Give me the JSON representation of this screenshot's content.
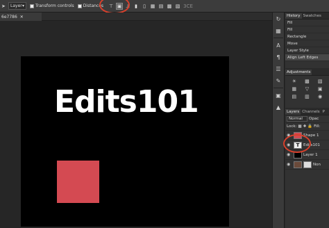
{
  "options_bar": {
    "layer_select": "Layer",
    "transform_controls": "Transform controls",
    "distances": "Distances",
    "extra": "3CE"
  },
  "document": {
    "tab_name": "6e7786"
  },
  "canvas": {
    "title": "Edits101",
    "square_color": "#d44a52"
  },
  "history": {
    "tabs": [
      "History",
      "Swatches"
    ],
    "items": [
      "Fill",
      "Fill",
      "Rectangle",
      "Move",
      "Layer Style",
      "Align Left Edges"
    ]
  },
  "adjustments": {
    "tab": "Adjustments"
  },
  "layers": {
    "tabs": [
      "Layers",
      "Channels",
      "P"
    ],
    "blend_mode": "Normal",
    "opacity_label": "Opac",
    "lock_label": "Lock:",
    "fill_label": "Fill:",
    "items": [
      {
        "name": "Shape 1"
      },
      {
        "name": "Edits101"
      },
      {
        "name": "Layer 1"
      },
      {
        "name": "Non"
      }
    ]
  }
}
